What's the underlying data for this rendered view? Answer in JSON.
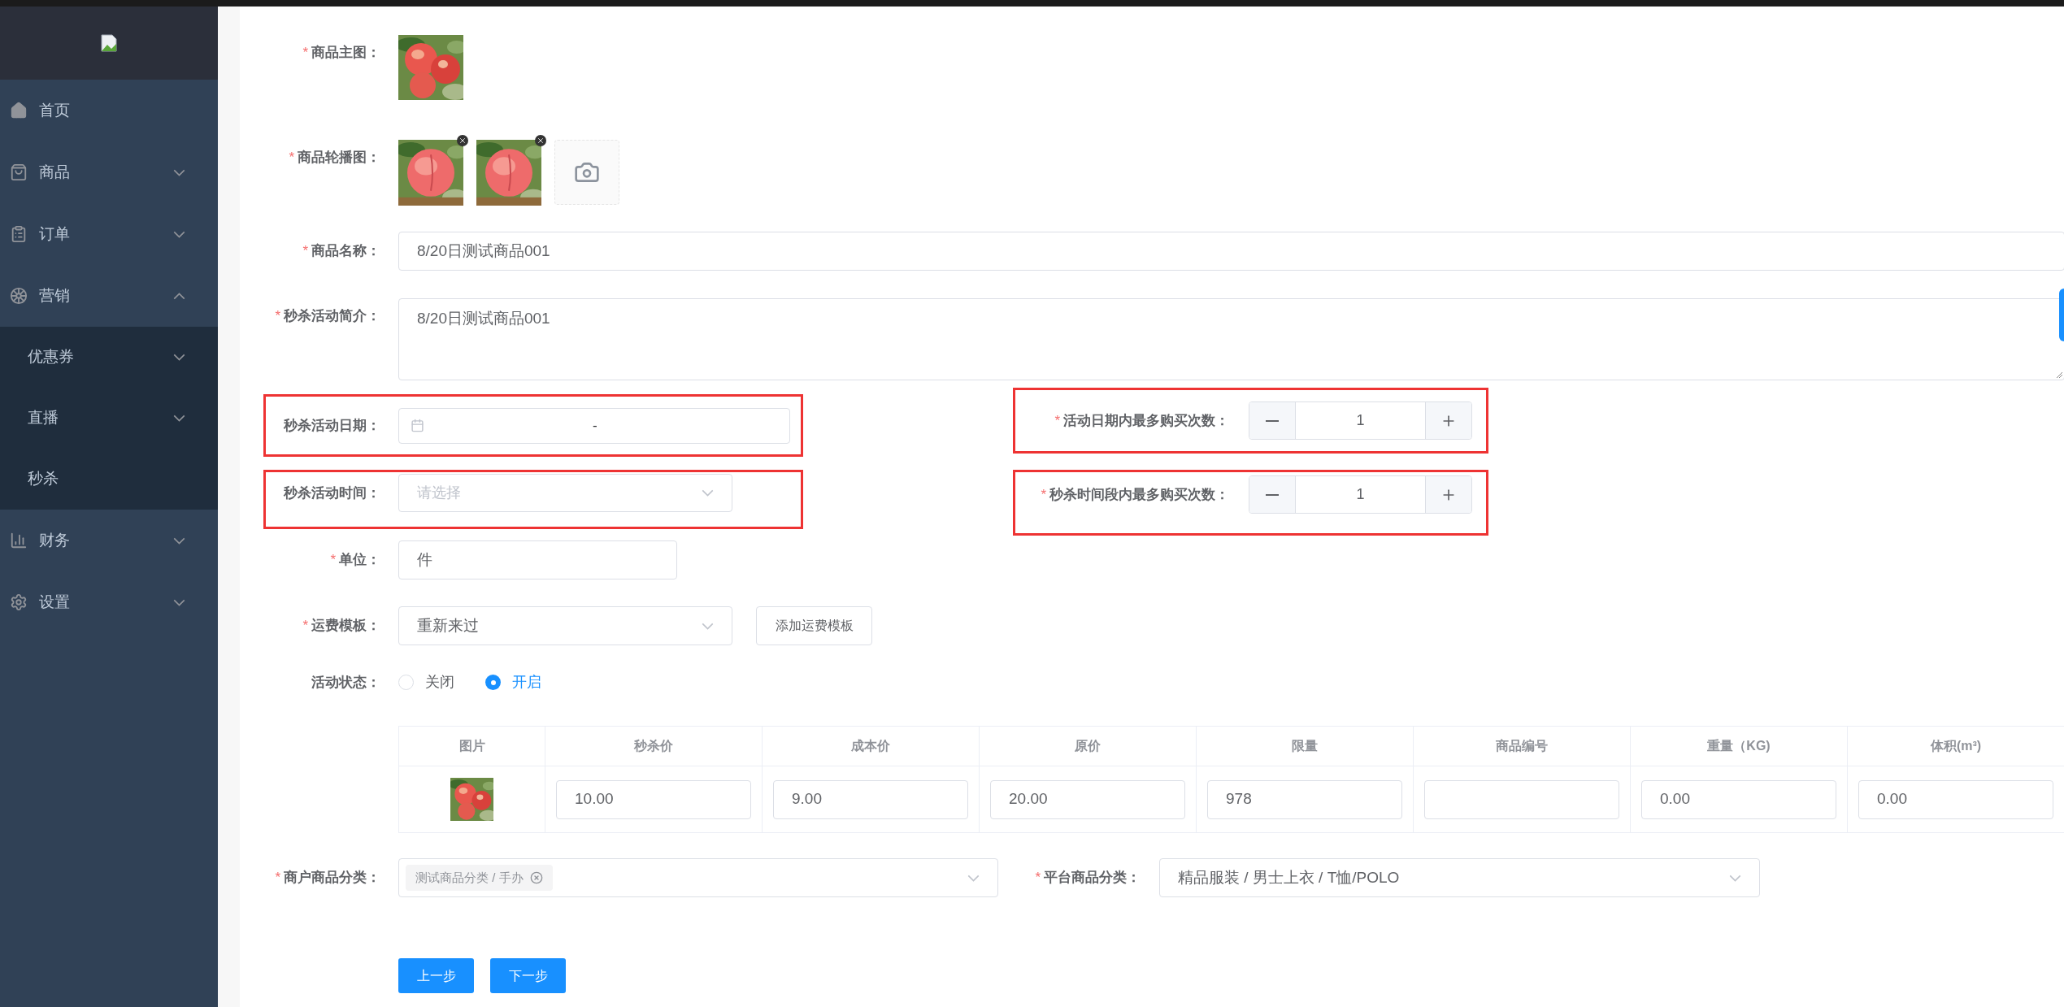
{
  "sidebar": {
    "items": [
      {
        "label": "首页",
        "kind": "link"
      },
      {
        "label": "商品",
        "kind": "submenu",
        "expanded": false
      },
      {
        "label": "订单",
        "kind": "submenu",
        "expanded": false
      },
      {
        "label": "营销",
        "kind": "submenu",
        "expanded": true,
        "children": [
          {
            "label": "优惠券",
            "kind": "submenu",
            "expanded": false
          },
          {
            "label": "直播",
            "kind": "submenu",
            "expanded": false
          },
          {
            "label": "秒杀",
            "kind": "link"
          }
        ]
      },
      {
        "label": "财务",
        "kind": "submenu",
        "expanded": false
      },
      {
        "label": "设置",
        "kind": "submenu",
        "expanded": false
      }
    ]
  },
  "form": {
    "main_image": {
      "mark": "*",
      "label": "商品主图："
    },
    "carousel": {
      "mark": "*",
      "label": "商品轮播图：",
      "images": [
        {
          "kind": "picture"
        },
        {
          "kind": "picture"
        }
      ]
    },
    "name": {
      "mark": "*",
      "label": "商品名称：",
      "value": "8/20日测试商品001"
    },
    "intro": {
      "mark": "*",
      "label": "秒杀活动简介：",
      "value": "8/20日测试商品001"
    },
    "date": {
      "label": "秒杀活动日期：",
      "separator": "-"
    },
    "date_limit": {
      "mark": "*",
      "label": "活动日期内最多购买次数：",
      "value": "1"
    },
    "time": {
      "label": "秒杀活动时间：",
      "placeholder": "请选择"
    },
    "time_limit": {
      "mark": "*",
      "label": "秒杀时间段内最多购买次数：",
      "value": "1"
    },
    "unit": {
      "mark": "*",
      "label": "单位：",
      "value": "件"
    },
    "shipping": {
      "mark": "*",
      "label": "运费模板：",
      "value": "重新来过",
      "button": "添加运费模板"
    },
    "status": {
      "label": "活动状态：",
      "options": [
        {
          "label": "关闭",
          "selected": false
        },
        {
          "label": "开启",
          "selected": true
        }
      ]
    },
    "table": {
      "columns": [
        "图片",
        "秒杀价",
        "成本价",
        "原价",
        "限量",
        "商品编号",
        "重量（KG)",
        "体积(m³)"
      ],
      "rows": [
        {
          "picture": {
            "kind": "picture"
          },
          "cells": [
            {
              "value": "10.00"
            },
            {
              "value": "9.00"
            },
            {
              "value": "20.00"
            },
            {
              "value": "978"
            },
            {},
            {
              "value": "0.00"
            },
            {
              "value": "0.00"
            }
          ]
        }
      ]
    },
    "merchant_category": {
      "mark": "*",
      "label": "商户商品分类：",
      "tags": [
        "测试商品分类 / 手办"
      ]
    },
    "platform_category": {
      "mark": "*",
      "label": "平台商品分类：",
      "value": "精品服装 / 男士上衣 / T恤/POLO"
    }
  },
  "buttons": [
    "上一步",
    "下一步"
  ]
}
